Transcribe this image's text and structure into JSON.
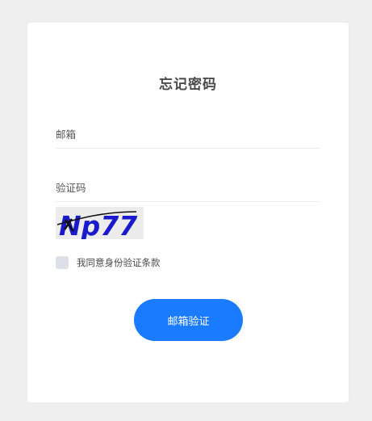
{
  "form": {
    "title": "忘记密码",
    "email_placeholder": "邮箱",
    "code_placeholder": "验证码",
    "captcha_text": "Np77",
    "agree_label": "我同意身份验证条款",
    "submit_label": "邮箱验证"
  },
  "colors": {
    "background": "#efefef",
    "card": "#ffffff",
    "primary": "#1a7bff",
    "checkbox": "#dde1e7",
    "captcha_text": "#1a1acc"
  }
}
